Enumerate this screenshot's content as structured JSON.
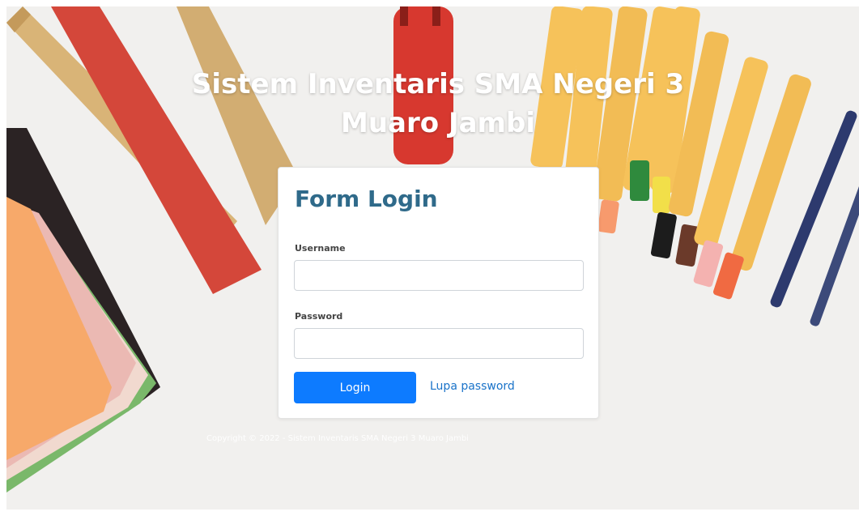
{
  "header": {
    "title_line1": "Sistem Inventaris SMA Negeri 3",
    "title_line2": "Muaro Jambi"
  },
  "login_form": {
    "title": "Form Login",
    "username_label": "Username",
    "username_value": "",
    "password_label": "Password",
    "password_value": "",
    "login_button_label": "Login",
    "forgot_password_label": "Lupa password"
  },
  "footer": {
    "copyright": "Copyright © 2022 - Sistem Inventaris SMA Negeri 3 Muaro Jambi"
  },
  "colors": {
    "title_text": "#2f6a8a",
    "primary_button": "#0d7bff",
    "link": "#1a73c9"
  }
}
